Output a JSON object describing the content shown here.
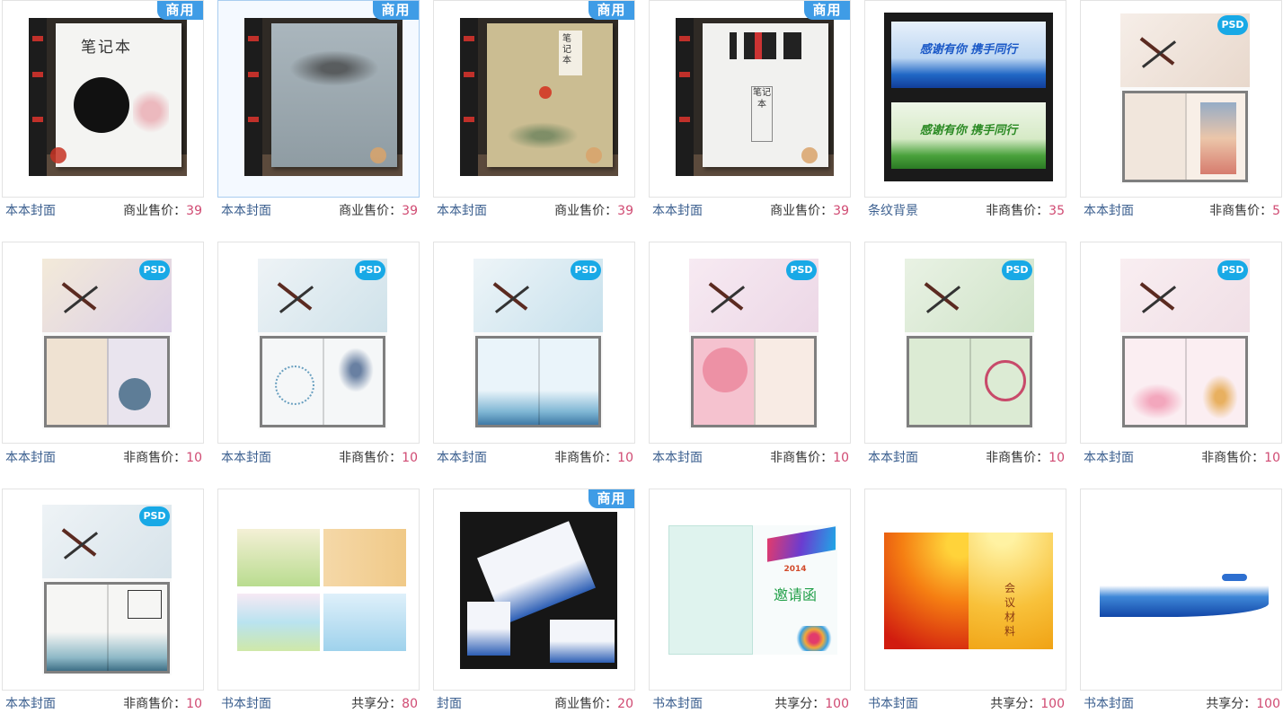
{
  "badge_label": "商用",
  "psd_logo": "PSD",
  "items": [
    {
      "category": "本本封面",
      "price_label": "商业售价：",
      "price": "39",
      "commercial": true
    },
    {
      "category": "本本封面",
      "price_label": "商业售价：",
      "price": "39",
      "commercial": true
    },
    {
      "category": "本本封面",
      "price_label": "商业售价：",
      "price": "39",
      "commercial": true
    },
    {
      "category": "本本封面",
      "price_label": "商业售价：",
      "price": "39",
      "commercial": true
    },
    {
      "category": "条纹背景",
      "price_label": "非商售价：",
      "price": "35",
      "commercial": false
    },
    {
      "category": "本本封面",
      "price_label": "非商售价：",
      "price": "5",
      "commercial": false
    },
    {
      "category": "本本封面",
      "price_label": "非商售价：",
      "price": "10",
      "commercial": false
    },
    {
      "category": "本本封面",
      "price_label": "非商售价：",
      "price": "10",
      "commercial": false
    },
    {
      "category": "本本封面",
      "price_label": "非商售价：",
      "price": "10",
      "commercial": false
    },
    {
      "category": "本本封面",
      "price_label": "非商售价：",
      "price": "10",
      "commercial": false
    },
    {
      "category": "本本封面",
      "price_label": "非商售价：",
      "price": "10",
      "commercial": false
    },
    {
      "category": "本本封面",
      "price_label": "非商售价：",
      "price": "10",
      "commercial": false
    },
    {
      "category": "本本封面",
      "price_label": "非商售价：",
      "price": "10",
      "commercial": false
    },
    {
      "category": "书本封面",
      "price_label": "共享分：",
      "price": "80",
      "commercial": false
    },
    {
      "category": "封面",
      "price_label": "商业售价：",
      "price": "20",
      "commercial": true
    },
    {
      "category": "书本封面",
      "price_label": "共享分：",
      "price": "100",
      "commercial": false
    },
    {
      "category": "书本封面",
      "price_label": "共享分：",
      "price": "100",
      "commercial": false
    },
    {
      "category": "书本封面",
      "price_label": "共享分：",
      "price": "100",
      "commercial": false
    }
  ],
  "image_text": {
    "notebook_1": "笔记本",
    "notebook_2": "笔记本",
    "notebook_4": "笔记本",
    "invite_year": "2014",
    "invite_title": "邀请函",
    "meeting_title": "会议材料",
    "banner_title": "感谢有你 携手同行"
  },
  "colors": {
    "badge": "#3f9ce6",
    "category": "#3b5f8f",
    "price": "#d04a72"
  }
}
